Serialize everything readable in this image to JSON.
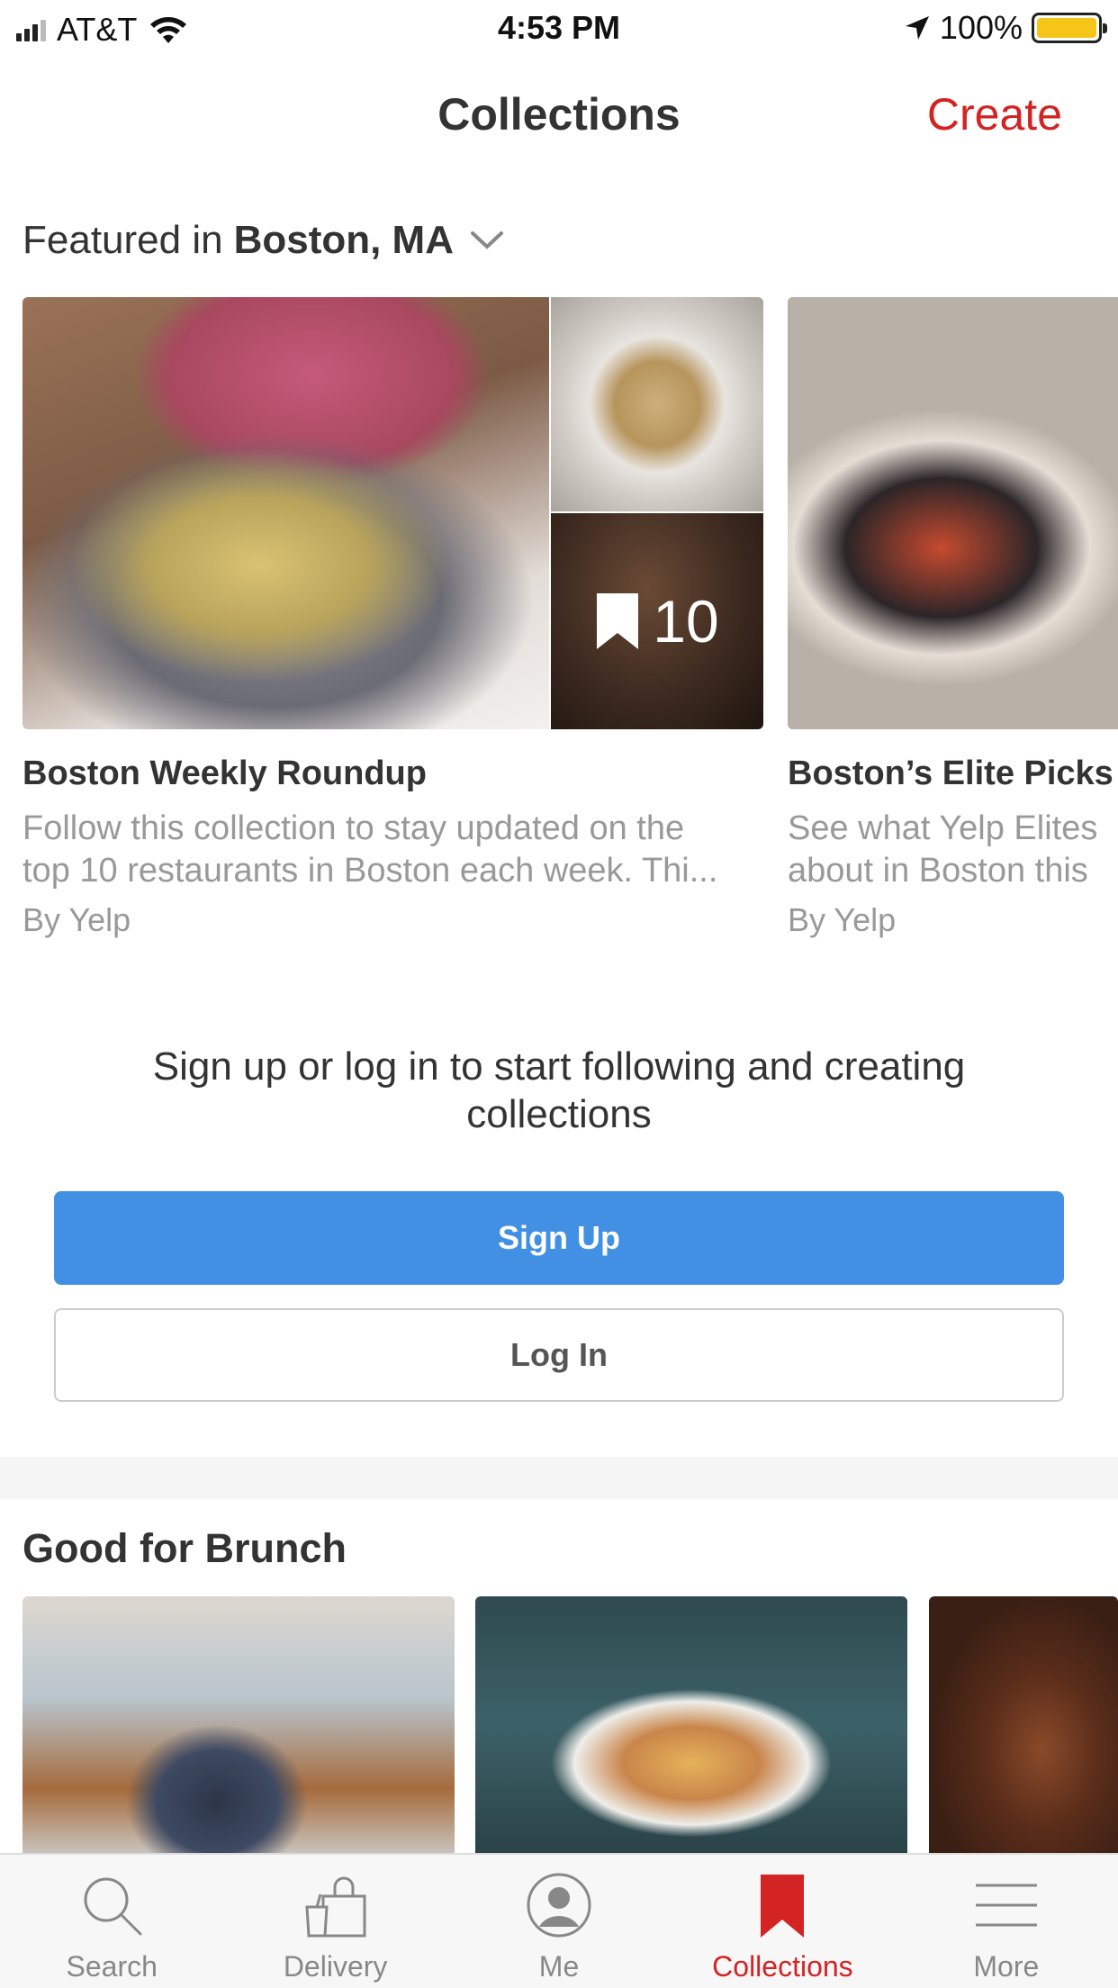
{
  "status_bar": {
    "carrier": "AT&T",
    "time": "4:53 PM",
    "battery": "100%"
  },
  "nav": {
    "title": "Collections",
    "create_label": "Create"
  },
  "featured": {
    "prefix": "Featured in",
    "city": "Boston, MA",
    "cards": [
      {
        "title": "Boston Weekly Roundup",
        "description_lines": [
          "Follow this collection to stay updated on the",
          "top 10 restaurants in Boston each week. Thi..."
        ],
        "byline": "By Yelp",
        "bookmark_count": "10"
      },
      {
        "title": "Boston’s Elite Picks",
        "description_lines": [
          "See what Yelp Elites",
          "about in Boston this"
        ],
        "byline": "By Yelp"
      }
    ]
  },
  "signup": {
    "prompt": "Sign up or log in to start following and creating collections",
    "signup_label": "Sign Up",
    "login_label": "Log In"
  },
  "brunch": {
    "title": "Good for Brunch"
  },
  "tab_bar": {
    "tabs": [
      {
        "label": "Search",
        "icon": "search-icon"
      },
      {
        "label": "Delivery",
        "icon": "bag-icon"
      },
      {
        "label": "Me",
        "icon": "person-icon"
      },
      {
        "label": "Collections",
        "icon": "bookmark-icon",
        "active": true
      },
      {
        "label": "More",
        "icon": "menu-icon"
      }
    ]
  },
  "colors": {
    "brand_red": "#d32323",
    "primary_blue": "#4190e3",
    "battery_yellow": "#f5c518"
  }
}
